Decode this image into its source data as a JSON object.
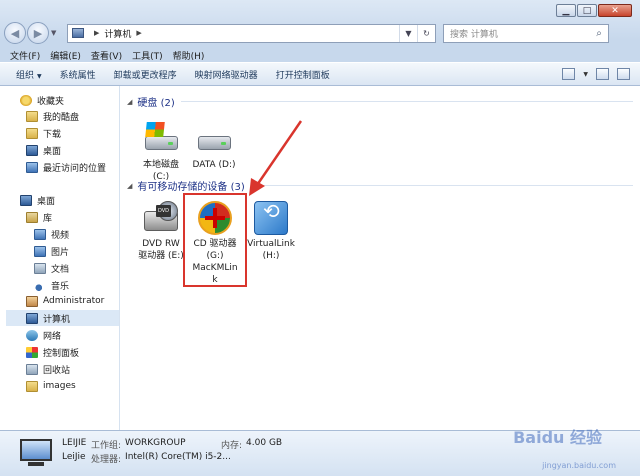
{
  "window": {
    "controls": [
      "minimize",
      "maximize",
      "close"
    ]
  },
  "address": {
    "path": [
      "计算机"
    ],
    "search_placeholder": "搜索 计算机"
  },
  "menu": [
    "文件(F)",
    "编辑(E)",
    "查看(V)",
    "工具(T)",
    "帮助(H)"
  ],
  "commands": [
    "组织",
    "系统属性",
    "卸载或更改程序",
    "映射网络驱动器",
    "打开控制面板"
  ],
  "nav": {
    "favorites": {
      "label": "收藏夹",
      "items": [
        "我的酷盘",
        "下载",
        "桌面",
        "最近访问的位置"
      ]
    },
    "desktop": "桌面",
    "library": {
      "label": "库",
      "items": [
        "视频",
        "图片",
        "文档",
        "音乐"
      ]
    },
    "admin": "Administrator",
    "computer": "计算机",
    "others": [
      "网络",
      "控制面板",
      "回收站",
      "images"
    ]
  },
  "groups": {
    "hdd": {
      "title": "硬盘 (2)",
      "items": [
        {
          "label": "本地磁盘\n(C:)"
        },
        {
          "label": "DATA (D:)"
        }
      ]
    },
    "removable": {
      "title": "有可移动存储的设备 (3)",
      "items": [
        {
          "label": "DVD RW\n驱动器 (E:)"
        },
        {
          "label": "CD 驱动器\n(G:)\nMacKMLin\nk"
        },
        {
          "label": "VirtualLink\n(H:)"
        }
      ]
    }
  },
  "details": {
    "name": "LEIJIE",
    "workgroup_key": "工作组:",
    "workgroup": "WORKGROUP",
    "memory_key": "内存:",
    "memory": "4.00 GB",
    "user": "LeiJie",
    "cpu_key": "处理器:",
    "cpu": "Intel(R) Core(TM) i5-2..."
  },
  "watermark": {
    "text": "Baidu 经验",
    "url": "jingyan.baidu.com"
  }
}
